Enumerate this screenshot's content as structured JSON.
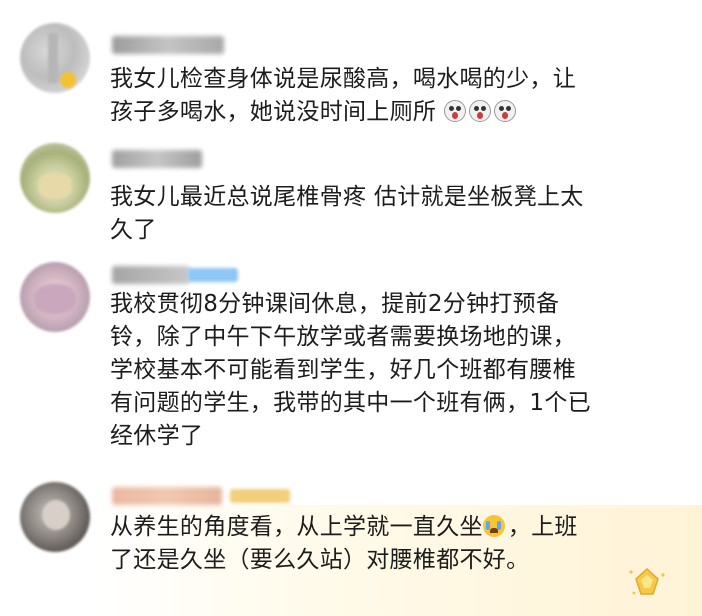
{
  "comments": [
    {
      "text_lines": [
        "我女儿检查身体说是尿酸高，喝水喝的少，让",
        "孩子多喝水，她说没时间上厕所"
      ],
      "emojis": [
        "shocked-face",
        "shocked-face",
        "shocked-face"
      ]
    },
    {
      "text_lines": [
        "我女儿最近总说尾椎骨疼  估计就是坐板凳上太",
        "久了"
      ]
    },
    {
      "text_lines": [
        "我校贯彻8分钟课间休息，提前2分钟打预备",
        "铃，除了中午下午放学或者需要换场地的课，",
        "学校基本不可能看到学生，好几个班都有腰椎",
        "有问题的学生，我带的其中一个班有俩，1个已",
        "经休学了"
      ]
    },
    {
      "text_lines": [
        "从养生的角度看，从上学就一直久坐",
        "了还是久坐（要么久站）对腰椎都不好。"
      ],
      "line1_tail": "，上班",
      "emojis": [
        "crying-face"
      ],
      "highlighted": true
    }
  ],
  "colors": {
    "background": "#ffffff",
    "text": "#1c1c1c",
    "highlight": "#fff3d6",
    "badge_blue": "#8fc6f5",
    "badge_gold": "#f2cf7a"
  },
  "icons": [
    "reward-gem-icon"
  ]
}
